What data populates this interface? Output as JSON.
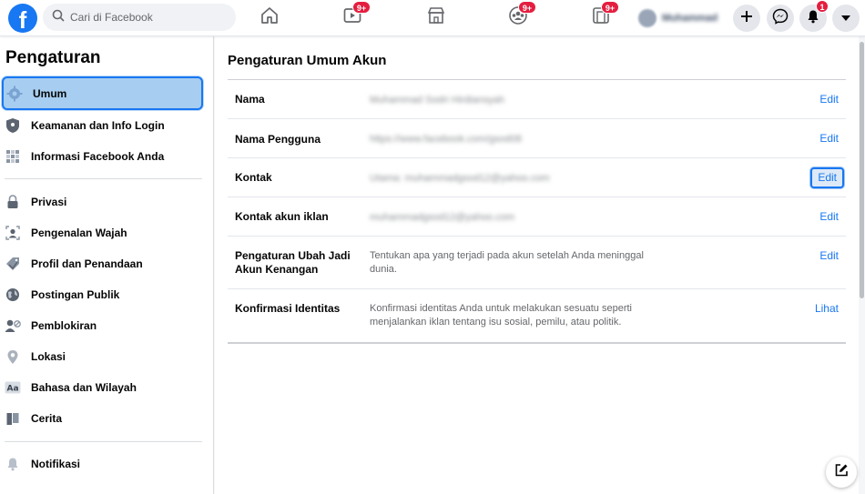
{
  "topbar": {
    "logo": "f",
    "search_placeholder": "Cari di Facebook",
    "watch_badge": "9+",
    "groups_badge": "9+",
    "gaming_badge": "9+",
    "notif_badge": "1",
    "profile_name": "Muhammad"
  },
  "sidebar": {
    "title": "Pengaturan",
    "items": [
      {
        "label": "Umum",
        "icon": "gear-icon"
      },
      {
        "label": "Keamanan dan Info Login",
        "icon": "shield-icon"
      },
      {
        "label": "Informasi Facebook Anda",
        "icon": "grid-icon"
      },
      {
        "label": "Privasi",
        "icon": "lock-icon"
      },
      {
        "label": "Pengenalan Wajah",
        "icon": "face-icon"
      },
      {
        "label": "Profil dan Penandaan",
        "icon": "tag-icon"
      },
      {
        "label": "Postingan Publik",
        "icon": "globe-icon"
      },
      {
        "label": "Pemblokiran",
        "icon": "block-user-icon"
      },
      {
        "label": "Lokasi",
        "icon": "location-pin-icon"
      },
      {
        "label": "Bahasa dan Wilayah",
        "icon": "language-icon"
      },
      {
        "label": "Cerita",
        "icon": "book-icon"
      },
      {
        "label": "Notifikasi",
        "icon": "bell-icon"
      }
    ]
  },
  "main": {
    "title": "Pengaturan Umum Akun",
    "rows": [
      {
        "label": "Nama",
        "value": "Muhammad Sodri Hirdiansyah",
        "action": "Edit"
      },
      {
        "label": "Nama Pengguna",
        "value": "https://www.facebook.com/gsod08",
        "action": "Edit"
      },
      {
        "label": "Kontak",
        "value": "Utama: muhammadgsod12@yahoo.com",
        "action": "Edit"
      },
      {
        "label": "Kontak akun iklan",
        "value": "muhammadgsod12@yahoo.com",
        "action": "Edit"
      },
      {
        "label": "Pengaturan Ubah Jadi Akun Kenangan",
        "value": "Tentukan apa yang terjadi pada akun setelah Anda meninggal dunia.",
        "action": "Edit"
      },
      {
        "label": "Konfirmasi Identitas",
        "value": "Konfirmasi identitas Anda untuk melakukan sesuatu seperti menjalankan iklan tentang isu sosial, pemilu, atau politik.",
        "action": "Lihat"
      }
    ]
  },
  "colors": {
    "accent": "#1877f2",
    "badge": "#e41e3f",
    "active_bg": "#a7cdf0"
  }
}
